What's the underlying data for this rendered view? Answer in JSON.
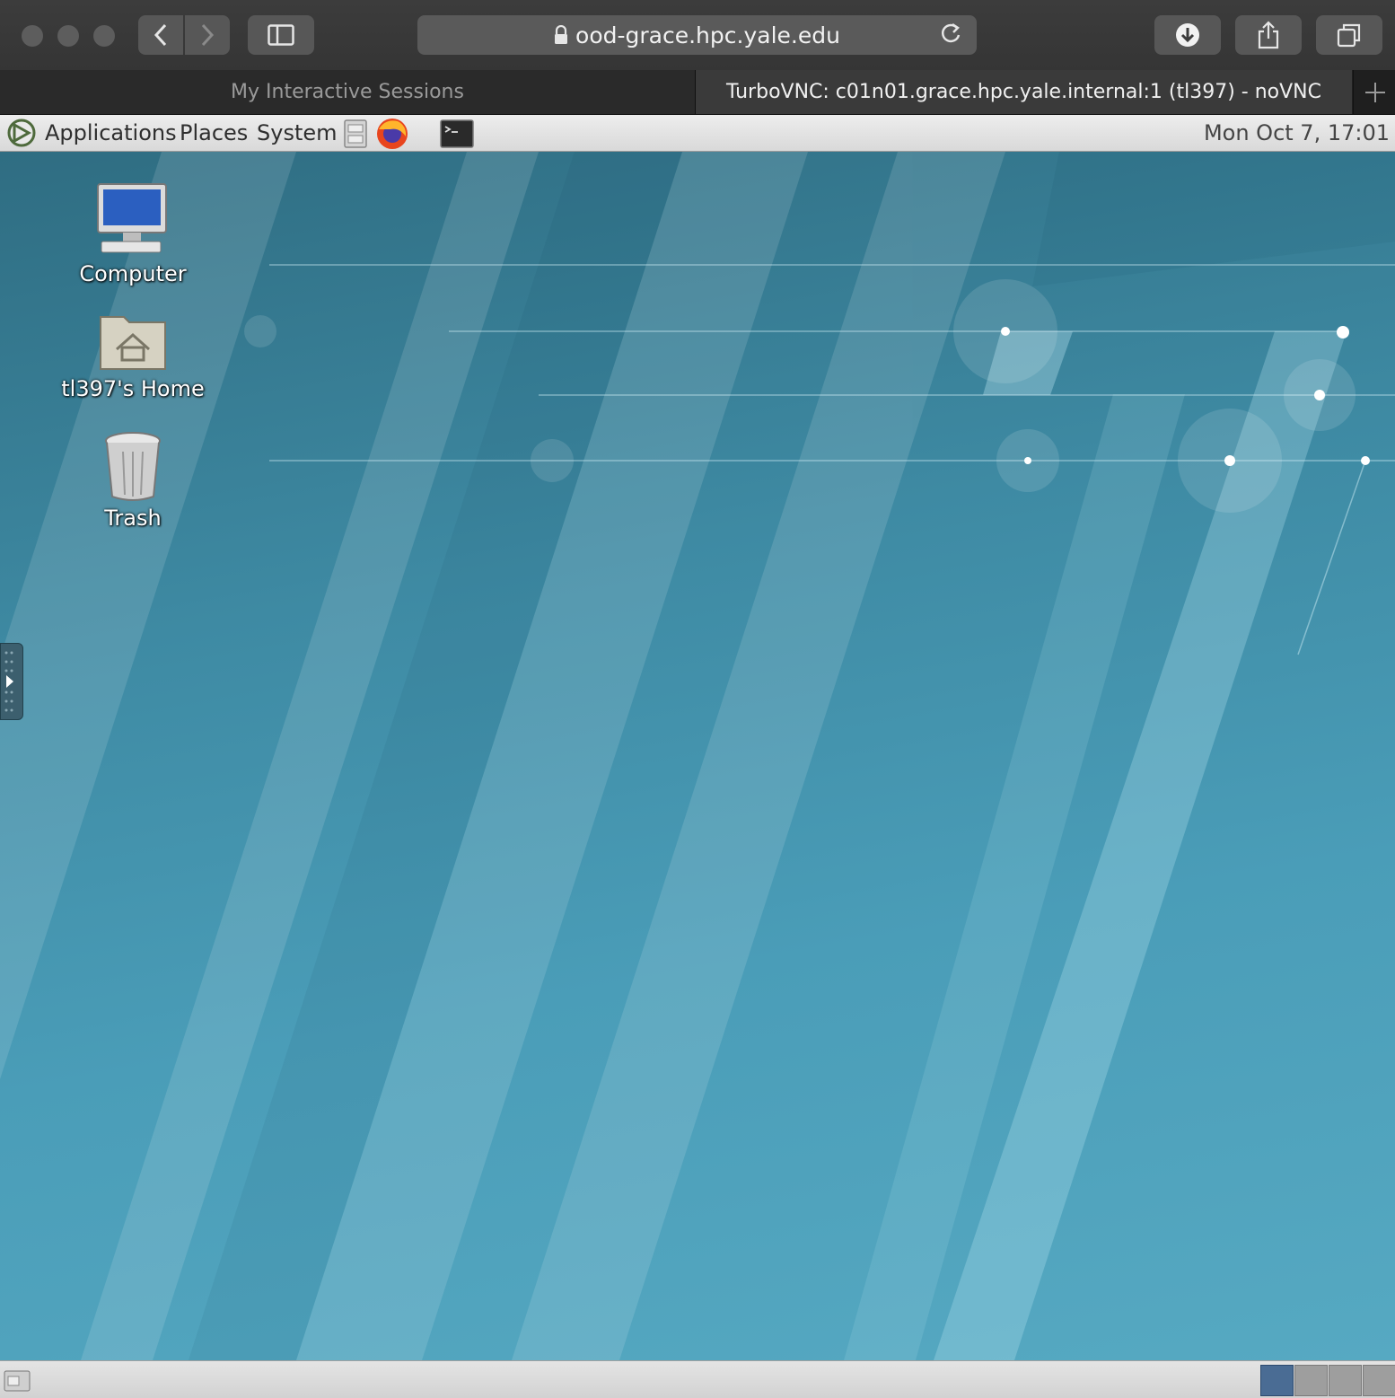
{
  "browser": {
    "url": "ood-grace.hpc.yale.edu",
    "tabs": [
      {
        "label": "My Interactive Sessions",
        "active": false
      },
      {
        "label": "TurboVNC: c01n01.grace.hpc.yale.internal:1 (tl397) - noVNC",
        "active": true
      }
    ],
    "icons": [
      "back-icon",
      "forward-icon",
      "sidebar-icon",
      "lock-icon",
      "reload-icon",
      "download-icon",
      "share-icon",
      "tabs-overview-icon",
      "new-tab-icon"
    ]
  },
  "panel": {
    "menus": {
      "applications": "Applications",
      "places": "Places",
      "system": "System"
    },
    "launchers": [
      "file-manager-icon",
      "firefox-icon",
      "terminal-icon"
    ],
    "clock": "Mon Oct  7, 17:01"
  },
  "desktop": {
    "icons": [
      {
        "label": "Computer",
        "icon": "computer-icon"
      },
      {
        "label": "tl397's Home",
        "icon": "home-folder-icon"
      },
      {
        "label": "Trash",
        "icon": "trash-icon"
      }
    ]
  },
  "workspaces": {
    "count": 4,
    "active": 1
  },
  "colors": {
    "desktop_bg": "#4a9db8",
    "workspace_active": "#4a6c94",
    "panel_bg": "#e0e0e0"
  }
}
